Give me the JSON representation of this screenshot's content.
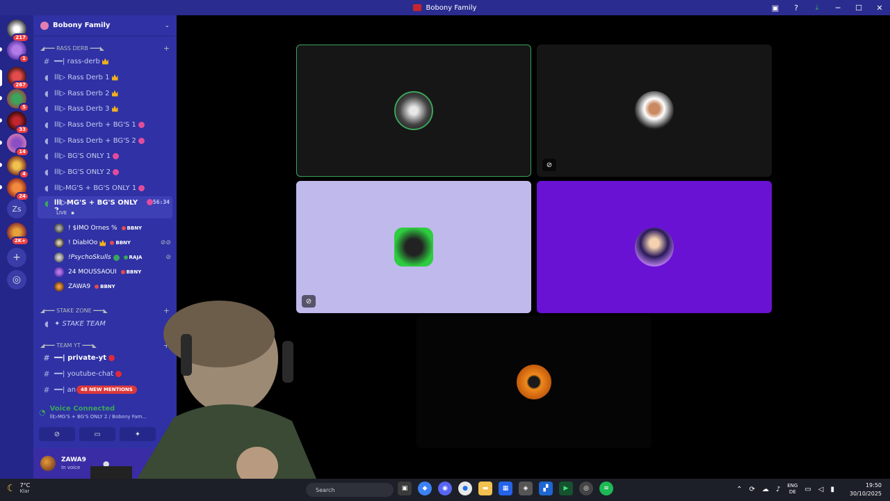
{
  "window": {
    "title": "Bobony Family"
  },
  "servers": [
    {
      "badge": "217"
    },
    {
      "badge": "1"
    },
    {
      "badge": "267"
    },
    {
      "badge": "5"
    },
    {
      "badge": "33"
    },
    {
      "badge": "14"
    },
    {
      "badge": "4"
    },
    {
      "badge": "24"
    },
    {
      "label": "Zs"
    },
    {
      "badge": "2K+"
    }
  ],
  "guild": {
    "name": "Bobony Family"
  },
  "categories": {
    "rass_derb": "◢━━━ RASS DERB ━━━◣",
    "stake_zone": "◢━━━ STAKE ZONE ━━━◣",
    "team_yt": "◢━━━ TEAM YT ━━━◣"
  },
  "channels": [
    {
      "name": "━━| rass-derb"
    },
    {
      "name": "lll▷ Rass Derb 1"
    },
    {
      "name": "lll▷ Rass Derb 2"
    },
    {
      "name": "lll▷ Rass Derb 3"
    },
    {
      "name": "lll▷ Rass Derb + BG'S 1"
    },
    {
      "name": "lll▷ Rass Derb + BG'S 2"
    },
    {
      "name": "lll▷ BG'S ONLY 1"
    },
    {
      "name": "lll▷ BG'S ONLY 2"
    },
    {
      "name": "lll▷MG'S + BG'S ONLY 1"
    },
    {
      "name": "lll▷MG'S + BG'S ONLY 2",
      "timer": "56:34",
      "live": "LIVE"
    },
    {
      "name": "✦ STAKE TEAM"
    },
    {
      "name": "━━| private-yt"
    },
    {
      "name": "━━| youtube-chat"
    },
    {
      "name": "━━| an"
    }
  ],
  "voice_users": [
    {
      "name": "! $IMO Ornes %",
      "tag": "BBNY"
    },
    {
      "name": "! DiabIOo",
      "tag": "BBNY"
    },
    {
      "name": "!PsychoSkulls",
      "tag": "RAJA"
    },
    {
      "name": "24 MOUSSAOUI",
      "tag": "BBNY"
    },
    {
      "name": "ZAWA9",
      "tag": "BBNY"
    }
  ],
  "mentions_label": "48 NEW MENTIONS",
  "voice": {
    "status": "Voice Connected",
    "channel": "lll▷MG'S + BG'S ONLY 2 / Bobony Fam..."
  },
  "user": {
    "name": "ZAWA9",
    "status": "In voice"
  },
  "taskbar": {
    "temp": "7°C",
    "weather": "Klar",
    "search_placeholder": "Search",
    "lang1": "ENG",
    "lang2": "DE",
    "time": "19:50",
    "date": "30/10/2025"
  },
  "colors": {
    "server_bar": "#24268a",
    "channel_bar": "#2f31a4",
    "accent_green": "#3ba55d",
    "mention_red": "#da373c"
  }
}
